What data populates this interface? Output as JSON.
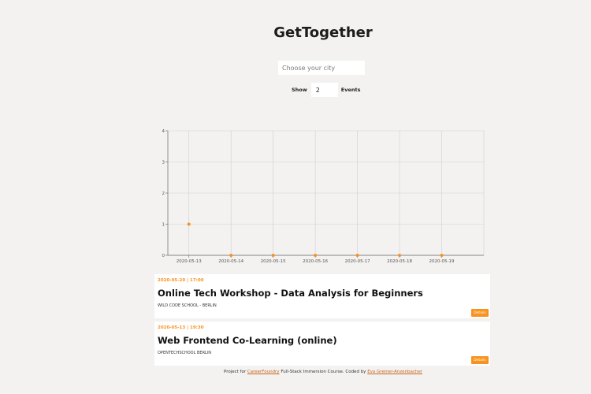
{
  "header": {
    "title": "GetTogether"
  },
  "search": {
    "placeholder": "Choose your city",
    "value": ""
  },
  "number_of_events": {
    "label_before": "Show",
    "value": "2",
    "label_after": "Events"
  },
  "chart_data": {
    "type": "scatter",
    "x": [
      "2020-05-13",
      "2020-05-14",
      "2020-05-15",
      "2020-05-16",
      "2020-05-17",
      "2020-05-18",
      "2020-05-19"
    ],
    "y": [
      1,
      0,
      0,
      0,
      0,
      0,
      0
    ],
    "y_ticks": [
      0,
      1,
      2,
      3,
      4
    ],
    "ylim": [
      0,
      4
    ],
    "grid": true,
    "point_color": "#f7931e"
  },
  "events": [
    {
      "meta": "2020-05-20 | 17:00",
      "name": "Online Tech Workshop - Data Analysis for Beginners",
      "group": "WILD CODE SCHOOL - BERLIN",
      "button": "Details"
    },
    {
      "meta": "2020-05-13 | 19:30",
      "name": "Web Frontend Co-Learning (online)",
      "group": "OPENTECHSCHOOL BERLIN",
      "button": "Details"
    }
  ],
  "footer": {
    "text1": "Project for ",
    "link1": "CareerFoundry",
    "text2": " Full-Stack Immersion Course. Coded by ",
    "link2": "Eva Greiner-Anzenbacher"
  },
  "colors": {
    "accent": "#f7931e",
    "background": "#f3f2f1",
    "link": "#c7641a"
  }
}
